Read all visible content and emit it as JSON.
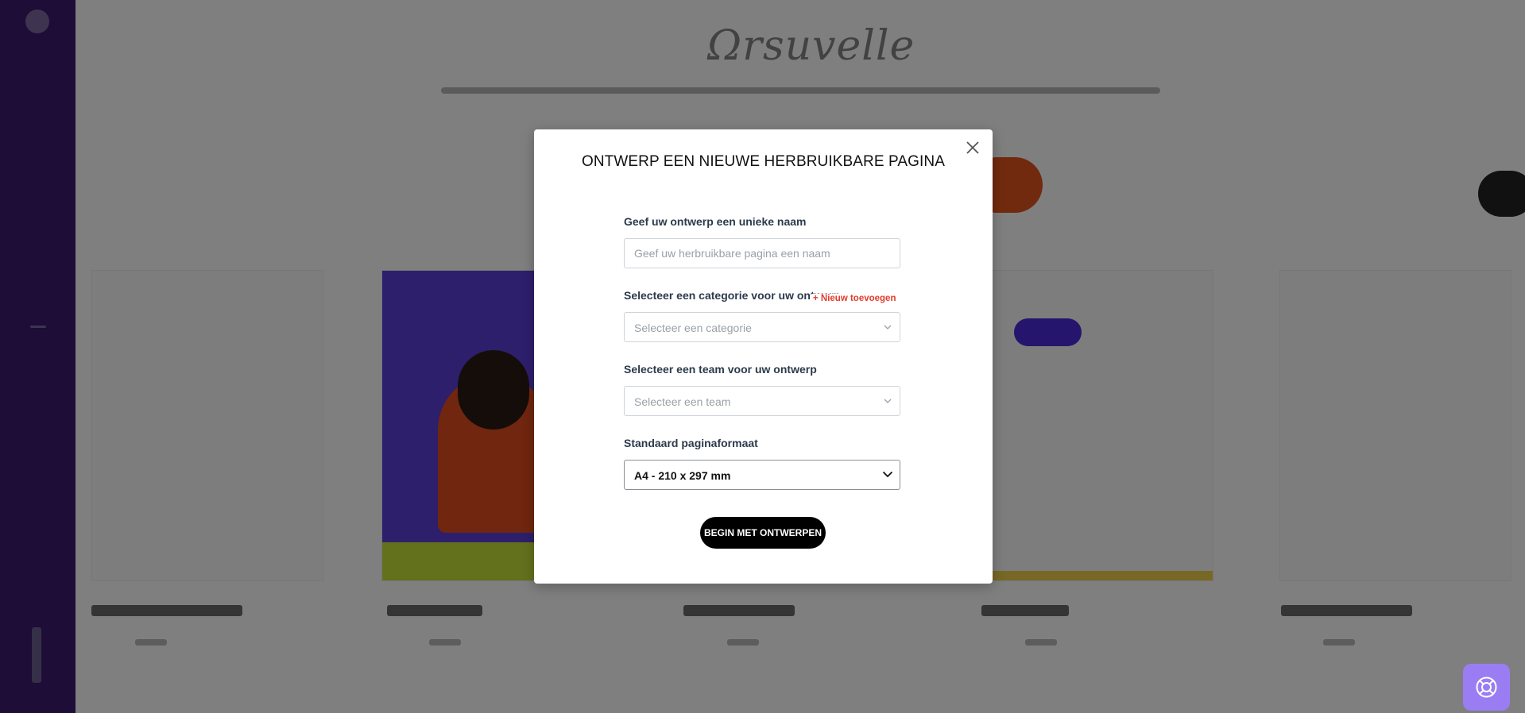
{
  "modal": {
    "title": "ONTWERP EEN NIEUWE HERBRUIKBARE PAGINA",
    "name_label": "Geef uw ontwerp een unieke naam",
    "name_placeholder": "Geef uw herbruikbare pagina een naam",
    "category_label": "Selecteer een categorie voor uw ontwerp",
    "add_new_label": "+ Nieuw toevoegen",
    "category_placeholder": "Selecteer een categorie",
    "team_label": "Selecteer een team voor uw ontwerp",
    "team_placeholder": "Selecteer een team",
    "page_format_label": "Standaard paginaformaat",
    "page_format_value": "A4 - 210 x 297 mm",
    "start_button": "BEGIN MET ONTWERPEN"
  },
  "icons": {
    "close": "close-icon",
    "chevron": "chevron-down-icon",
    "help": "lifebuoy-icon"
  },
  "colors": {
    "sidebar": "#3a1a6e",
    "accent_red": "#e23b2c",
    "help_button": "#9a7df2",
    "primary_button": "#000000"
  }
}
